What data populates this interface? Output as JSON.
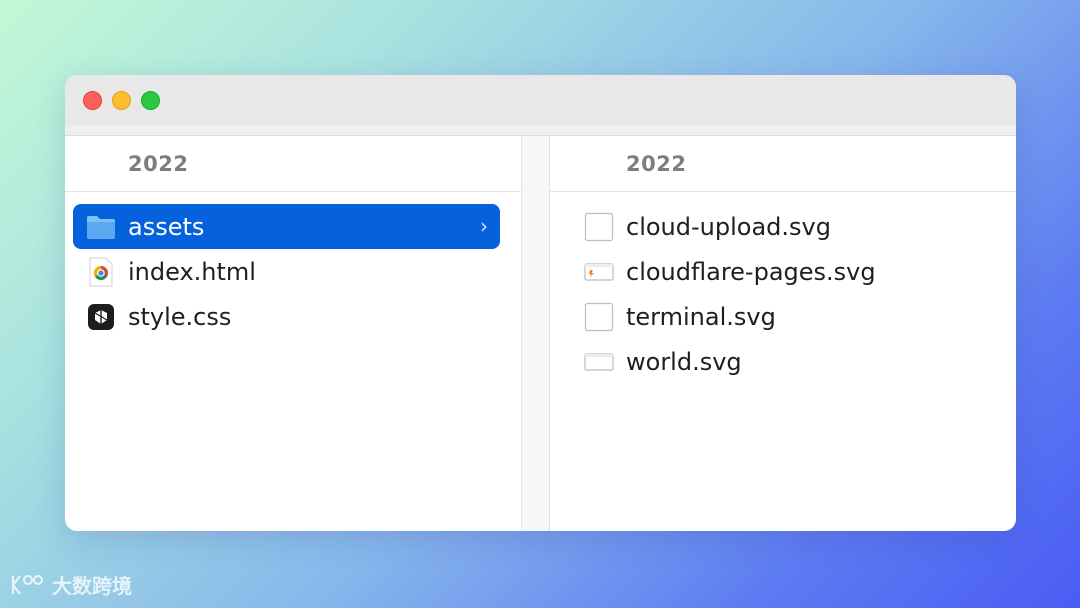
{
  "window": {
    "traffic_lights": [
      "close",
      "minimize",
      "maximize"
    ]
  },
  "left_column": {
    "header": "2022",
    "items": [
      {
        "name": "assets",
        "icon": "folder-icon",
        "selected": true
      },
      {
        "name": "index.html",
        "icon": "chrome-html-icon",
        "selected": false
      },
      {
        "name": "style.css",
        "icon": "css-file-icon",
        "selected": false
      }
    ]
  },
  "right_column": {
    "header": "2022",
    "items": [
      {
        "name": "cloud-upload.svg",
        "icon": "svg-file-icon"
      },
      {
        "name": "cloudflare-pages.svg",
        "icon": "svg-thumbnail-icon"
      },
      {
        "name": "terminal.svg",
        "icon": "svg-file-icon"
      },
      {
        "name": "world.svg",
        "icon": "svg-thumbnail-icon"
      }
    ]
  },
  "watermark": {
    "text": "大数跨境"
  },
  "colors": {
    "selection": "#0561dc",
    "folder": "#5aa9f0"
  }
}
